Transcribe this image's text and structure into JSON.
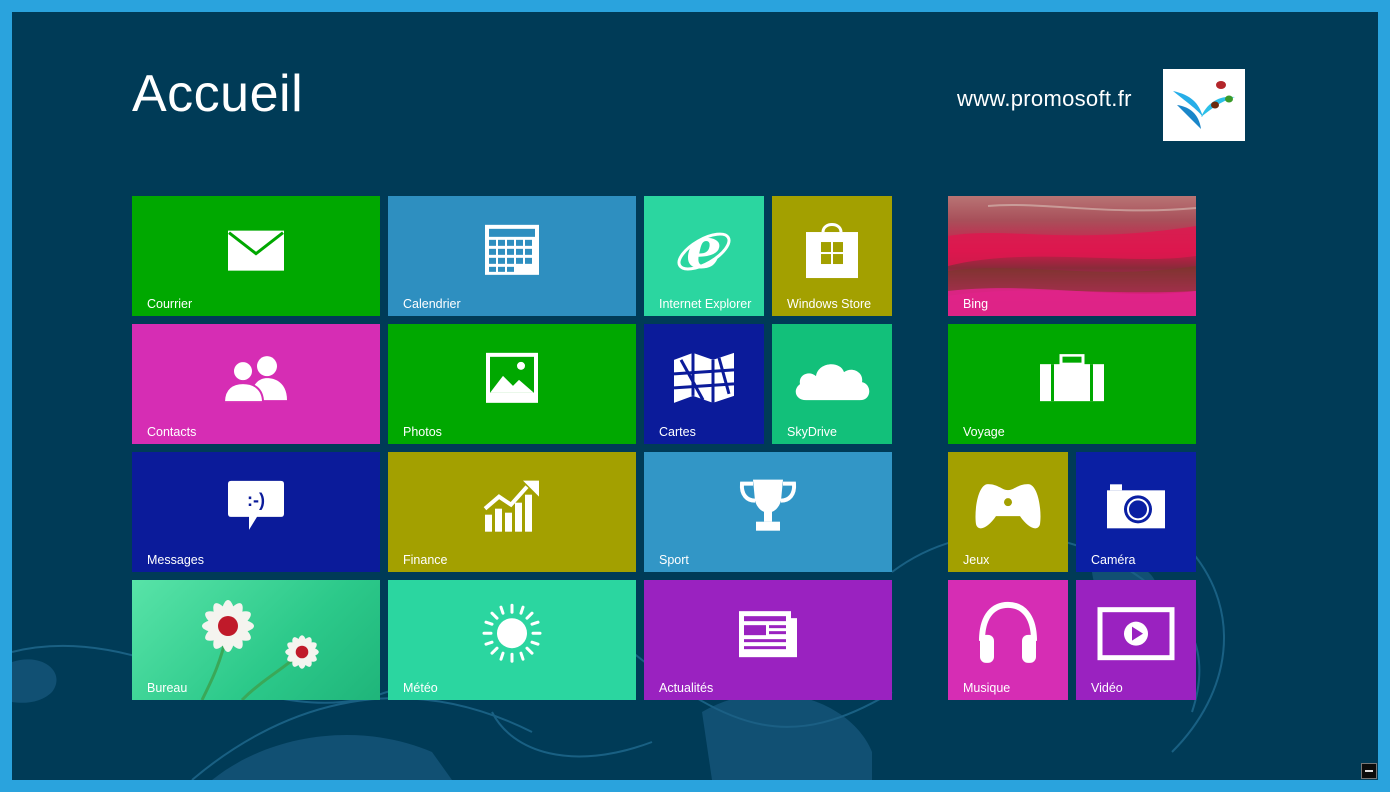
{
  "header": {
    "title": "Accueil",
    "site_url": "www.promosoft.fr"
  },
  "tiles": [
    {
      "label": "Courrier",
      "icon": "mail-icon",
      "color": "#00a800"
    },
    {
      "label": "Calendrier",
      "icon": "calendar-icon",
      "color": "#2e8fc0"
    },
    {
      "label": "Internet Explorer",
      "icon": "internet-explorer-icon",
      "color": "#2bd6a0"
    },
    {
      "label": "Windows Store",
      "icon": "store-bag-icon",
      "color": "#a3a000"
    },
    {
      "label": "Bing",
      "icon": "bing-landscape-image",
      "color": "#c0304a"
    },
    {
      "label": "Contacts",
      "icon": "people-icon",
      "color": "#d62db4"
    },
    {
      "label": "Photos",
      "icon": "photo-icon",
      "color": "#00a800"
    },
    {
      "label": "Cartes",
      "icon": "map-icon",
      "color": "#0b1b9a"
    },
    {
      "label": "SkyDrive",
      "icon": "cloud-icon",
      "color": "#12c07a"
    },
    {
      "label": "Voyage",
      "icon": "suitcase-icon",
      "color": "#00a800"
    },
    {
      "label": "Messages",
      "icon": "chat-bubble-icon",
      "color": "#0b1b9a"
    },
    {
      "label": "Finance",
      "icon": "chart-growth-icon",
      "color": "#a3a000"
    },
    {
      "label": "Sport",
      "icon": "trophy-icon",
      "color": "#3296c6"
    },
    {
      "label": "Jeux",
      "icon": "gamepad-icon",
      "color": "#a3a000"
    },
    {
      "label": "Caméra",
      "icon": "camera-icon",
      "color": "#0a1fa3"
    },
    {
      "label": "Bureau",
      "icon": "daisy-flower-image",
      "color": "#3fd98a"
    },
    {
      "label": "Météo",
      "icon": "sun-icon",
      "color": "#2bd6a0"
    },
    {
      "label": "Actualités",
      "icon": "newspaper-icon",
      "color": "#9a22c0"
    },
    {
      "label": "Musique",
      "icon": "headphones-icon",
      "color": "#d62db4"
    },
    {
      "label": "Vidéo",
      "icon": "video-play-icon",
      "color": "#9a22c0"
    }
  ],
  "glyphs": {
    "messages_emoticon": ":-)"
  }
}
